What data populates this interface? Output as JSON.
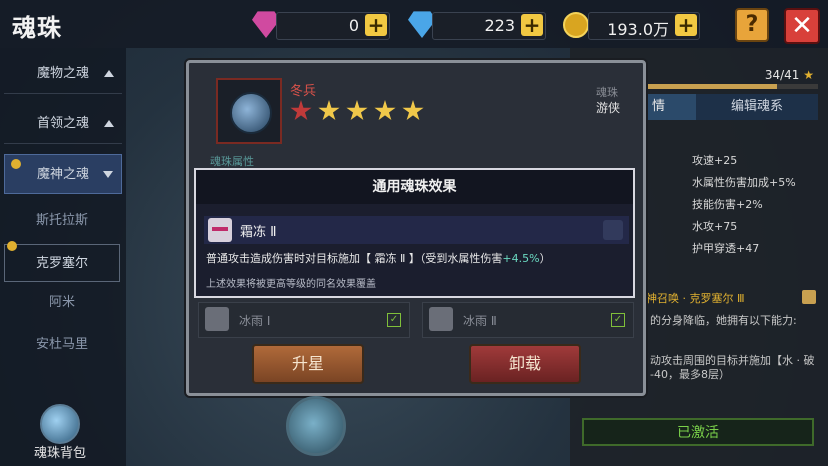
{
  "header": {
    "title": "魂珠",
    "resources": [
      {
        "icon": "pink-gem-icon",
        "value": "0"
      },
      {
        "icon": "blue-diamond-icon",
        "value": "223"
      },
      {
        "icon": "gold-coin-icon",
        "value": "193.0万"
      }
    ],
    "help_label": "?",
    "close_label": "✕"
  },
  "sidebar": {
    "categories": [
      {
        "label": "魔物之魂",
        "arrow": "up"
      },
      {
        "label": "首领之魂",
        "arrow": "up"
      },
      {
        "label": "魔神之魂",
        "arrow": "down",
        "active": true
      }
    ],
    "subitems": [
      {
        "label": "斯托拉斯"
      },
      {
        "label": "克罗塞尔",
        "selected": true
      },
      {
        "label": "阿米"
      },
      {
        "label": "安杜马里"
      }
    ],
    "bag_label": "魂珠背包"
  },
  "right_panel": {
    "count": "34/41",
    "progress": 0.83,
    "tab_active_fragment": "情",
    "tab_edit": "编辑魂系",
    "stats": [
      "攻速+25",
      "水属性伤害加成+5%",
      "技能伤害+2%",
      "水攻+75",
      "护甲穿透+47"
    ],
    "summon_title": "神召唤 · 克罗塞尔 Ⅲ",
    "summon_line1": "的分身降临，她拥有以下能力:",
    "summon_line2": "动攻击周围的目标并施加【水 · 破",
    "summon_line3": "-40，最多8层）",
    "activated_label": "已激活"
  },
  "modal": {
    "orb_name": "冬兵",
    "info_category": "魂珠",
    "info_class": "游侠",
    "attr_label": "魂珠属性",
    "stars": [
      "red",
      "gold",
      "gold",
      "gold",
      "gold"
    ]
  },
  "tooltip": {
    "title": "通用魂珠效果",
    "effect_name": "霜冻 Ⅱ",
    "desc_main": "普通攻击造成伤害时对目标施加【 霜冻 Ⅱ 】（受到水属性伤害",
    "desc_value": "+4.5%",
    "desc_tail": "）",
    "note": "上述效果将被更高等级的同名效果覆盖"
  },
  "effects": [
    {
      "label": "冰雨 Ⅰ",
      "checked": "✓"
    },
    {
      "label": "冰雨 Ⅱ",
      "checked": "✓"
    }
  ],
  "buttons": {
    "star_up": "升星",
    "unload": "卸载"
  },
  "colors": {
    "accent_red": "#d9524a",
    "star_gold": "#f0c84a",
    "highlight_cyan": "#6ad8c0",
    "active_green": "#7ad04a"
  }
}
